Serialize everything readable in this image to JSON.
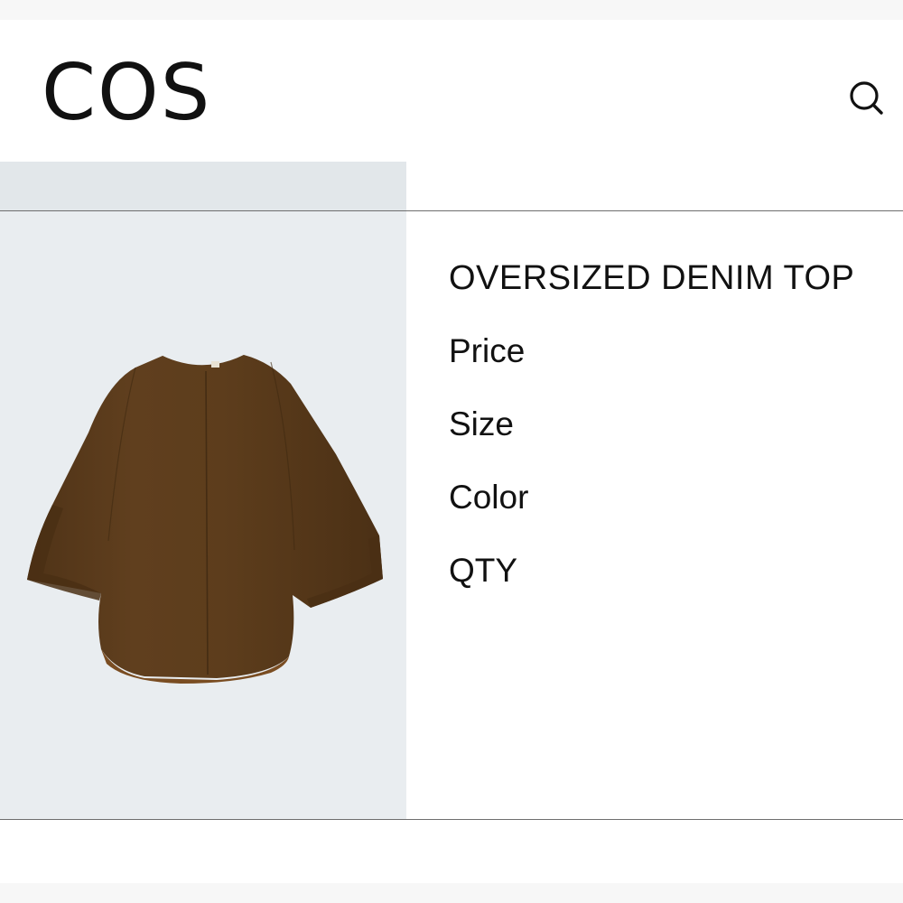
{
  "header": {
    "logo_text": "COS",
    "search_icon": "search-icon"
  },
  "product": {
    "image_icon": "brown-oversized-top-image",
    "title": "OVERSIZED DENIM TOP",
    "fields": {
      "price_label": "Price",
      "size_label": "Size",
      "color_label": "Color",
      "qty_label": "QTY"
    }
  },
  "colors": {
    "garment_brown": "#5e3e1c",
    "image_background": "#e9edf0",
    "text": "#111111",
    "divider": "#6e6e6e"
  }
}
